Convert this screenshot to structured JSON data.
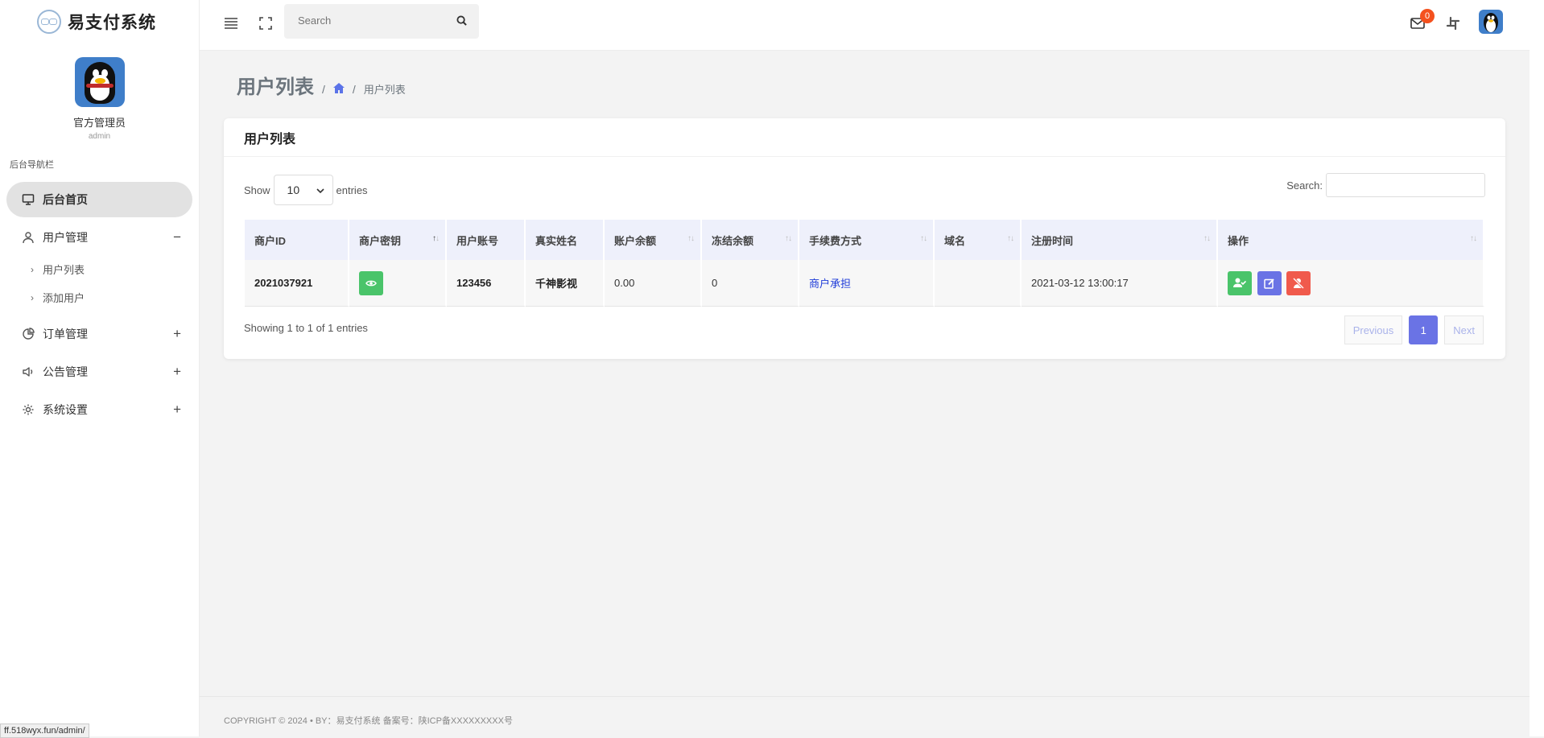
{
  "brand": {
    "name": "易支付系统"
  },
  "profile": {
    "name": "官方管理员",
    "role": "admin"
  },
  "nav": {
    "heading": "后台导航栏",
    "dashboard": "后台首页",
    "users": {
      "label": "用户管理",
      "toggle": "−",
      "children": [
        "用户列表",
        "添加用户"
      ]
    },
    "orders": {
      "label": "订单管理",
      "toggle": "+"
    },
    "notices": {
      "label": "公告管理",
      "toggle": "+"
    },
    "settings": {
      "label": "系统设置",
      "toggle": "+"
    }
  },
  "topbar": {
    "search_placeholder": "Search",
    "mail_count": "0"
  },
  "page": {
    "title": "用户列表",
    "breadcrumb_current": "用户列表"
  },
  "card": {
    "title": "用户列表",
    "show_label": "Show",
    "page_size": "10",
    "entries_label": "entries",
    "search_label": "Search:",
    "columns": [
      "商户ID",
      "商户密钥",
      "用户账号",
      "真实姓名",
      "账户余额",
      "冻结余额",
      "手续费方式",
      "域名",
      "注册时间",
      "操作"
    ],
    "rows": [
      {
        "merchant_id": "2021037921",
        "account": "123456",
        "real_name": "千神影视",
        "balance": "0.00",
        "frozen": "0",
        "fee_mode": "商户承担",
        "domain": "",
        "reg_time": "2021-03-12 13:00:17"
      }
    ],
    "info": "Showing 1 to 1 of 1 entries",
    "pager": {
      "prev": "Previous",
      "current": "1",
      "next": "Next"
    }
  },
  "footer": {
    "text": "COPYRIGHT © 2024  • BY：易支付系统    备案号：陕ICP备XXXXXXXXX号"
  },
  "status_url": "ff.518wyx.fun/admin/",
  "colors": {
    "accent": "#6a73e5",
    "success": "#4ac46a",
    "danger": "#f05a4c",
    "badge": "#f4511e"
  }
}
